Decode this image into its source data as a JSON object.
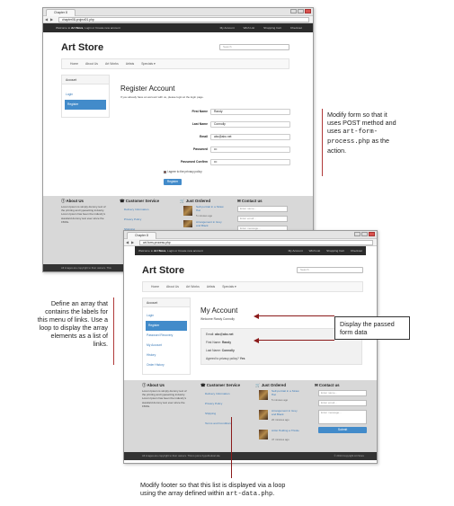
{
  "screenshot1": {
    "tab_title": "Chapter 8",
    "url": "chapter08-project01.php",
    "topbar": {
      "welcome_prefix": "Welcome to ",
      "welcome_bold": "Art Store",
      "welcome_suffix": ", Login or Create new account",
      "links": [
        "My Account",
        "Wish List",
        "Shopping Cart",
        "Checkout"
      ]
    },
    "brand": "Art Store",
    "search_placeholder": "Search",
    "nav": [
      "Home",
      "About Us",
      "Art Works",
      "Artists",
      "Specials ▾"
    ],
    "sidebar": {
      "header": "Account",
      "items": [
        "Login",
        "Register"
      ],
      "active": 1
    },
    "title": "Register Account",
    "subtitle": "If you already have an account with us, please login at the login page.",
    "fields": [
      {
        "label": "First Name",
        "value": "Randy"
      },
      {
        "label": "Last Name",
        "value": "Connolly"
      },
      {
        "label": "Email",
        "value": "abc@abc.net"
      },
      {
        "label": "Password",
        "value": "•••"
      },
      {
        "label": "Password Confirm",
        "value": "•••"
      }
    ],
    "agree_text": "I agree to the privacy policy",
    "register_button": "Register",
    "footer": {
      "about_title": "About Us",
      "about_text": "Lorem Ipsum is simply dummy text of the printing and typesetting industry. Lorem Ipsum has been the industry's standard dummy text ever since the 1500s.",
      "service_title": "Customer Service",
      "service_links": [
        "Delivery Information",
        "Privacy Policy",
        "Shipping"
      ],
      "ordered_title": "Just Ordered",
      "ordered": [
        {
          "title": "Self-portrait in a Straw Hat",
          "meta": "5 minutes ago"
        },
        {
          "title": "Arrangement in Grey and Black",
          "meta": ""
        }
      ],
      "contact_title": "Contact us",
      "contact_fields": [
        "Enter name...",
        "Enter email...",
        "Enter message..."
      ],
      "copyright": "All images are copyright to their owners. This"
    }
  },
  "screenshot2": {
    "tab_title": "Chapter 8",
    "url": "art-form-process.php",
    "topbar": {
      "welcome_prefix": "Welcome to ",
      "welcome_bold": "Art Store",
      "welcome_suffix": ", Login or Create new account",
      "links": [
        "My Account",
        "Wish List",
        "Shopping Cart",
        "Checkout"
      ]
    },
    "brand": "Art Store",
    "search_placeholder": "Search",
    "nav": [
      "Home",
      "About Us",
      "Art Works",
      "Artists",
      "Specials ▾"
    ],
    "sidebar": {
      "header": "Account",
      "items": [
        "Login",
        "Register",
        "Password Recovery",
        "My Account",
        "History",
        "Order History"
      ],
      "active": 1
    },
    "title": "My Account",
    "welcome": "Welcome Randy Connolly",
    "info": [
      {
        "label": "Email: ",
        "value": "abc@abc.net"
      },
      {
        "label": "First Name: ",
        "value": "Randy"
      },
      {
        "label": "Last Name: ",
        "value": "Connolly"
      },
      {
        "label": "Agreed to privacy policy? ",
        "value": "Yes"
      }
    ],
    "footer": {
      "about_title": "About Us",
      "about_text": "Lorem Ipsum is simply dummy text of the printing and typesetting industry. Lorem Ipsum has been the industry's standard dummy text ever since the 1500s.",
      "service_title": "Customer Service",
      "service_links": [
        "Delivery Information",
        "Privacy Policy",
        "Shipping",
        "Terms and Conditions"
      ],
      "ordered_title": "Just Ordered",
      "ordered": [
        {
          "title": "Self-portrait in a Straw Hat",
          "meta": "5 minutes ago"
        },
        {
          "title": "Arrangement in Grey and Black",
          "meta": "20 minutes ago"
        },
        {
          "title": "Artist Holding a Thistle",
          "meta": "47 minutes ago"
        }
      ],
      "contact_title": "Contact us",
      "contact_fields": [
        "Enter name...",
        "Enter email...",
        "Enter message..."
      ],
      "submit_label": "Submit",
      "copyright_left": "All images are copyright to their owners. This is just a hypothetical site",
      "copyright_right": "© 2014 Copyright Art Store"
    }
  },
  "annotations": {
    "form_method": {
      "line1": "Modify form so that it",
      "line2": "uses POST method and",
      "line3_prefix": "uses ",
      "line3_code": "art-form-",
      "line4_code": "process.php",
      "line4_suffix": " as the",
      "line5": "action."
    },
    "menu_array": {
      "lines": [
        "Define an array that",
        "contains the labels for",
        "this menu of links. Use a",
        "loop to display the array",
        "elements as a list of",
        "links."
      ]
    },
    "passed_data": {
      "line1": "Display the passed",
      "line2": "form data"
    },
    "footer_loop": {
      "line1": "Modify footer so that this list is displayed via a loop",
      "line2_prefix": "using the array defined within ",
      "line2_code": "art-data.php",
      "line2_suffix": "."
    }
  }
}
